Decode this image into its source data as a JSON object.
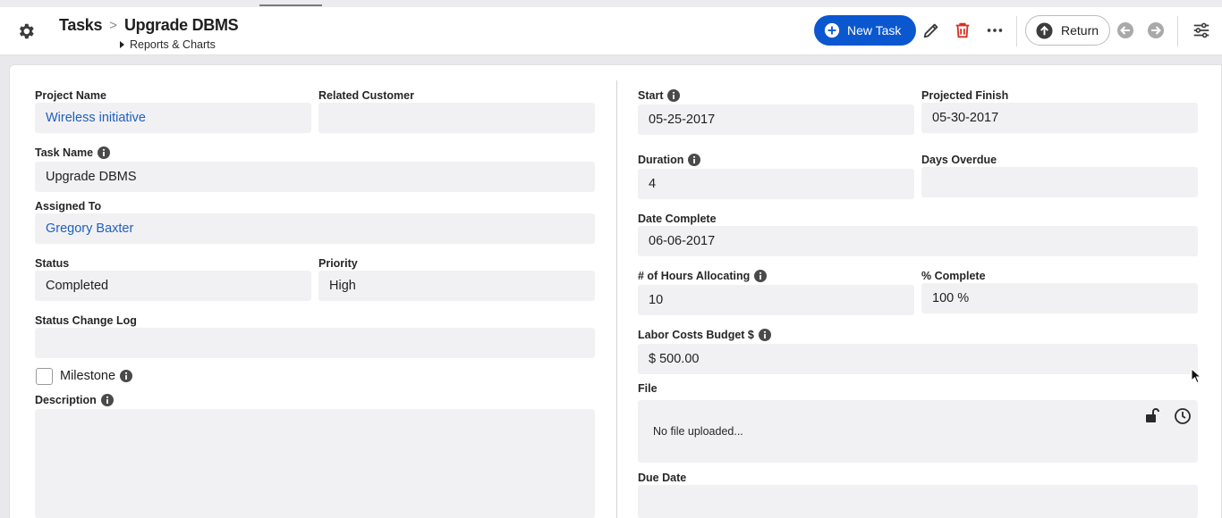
{
  "header": {
    "breadcrumb_root": "Tasks",
    "breadcrumb_sep": ">",
    "breadcrumb_current": "Upgrade DBMS",
    "subnav_label": "Reports & Charts",
    "new_task_label": "New Task",
    "return_label": "Return"
  },
  "colors": {
    "primary": "#0b57d0",
    "link": "#1f5fbf",
    "delete": "#d93025",
    "field_bg": "#f1f1f3"
  },
  "icons": [
    "gear-icon",
    "plus-circle-icon",
    "pencil-icon",
    "trash-icon",
    "more-horizontal-icon",
    "arrow-up-circle-icon",
    "arrow-left-circle-icon",
    "arrow-right-circle-icon",
    "sliders-icon",
    "info-icon",
    "unlock-icon",
    "clock-icon",
    "cursor-icon"
  ],
  "left": {
    "project_name": {
      "label": "Project Name",
      "value": "Wireless initiative"
    },
    "related_customer": {
      "label": "Related Customer",
      "value": ""
    },
    "task_name": {
      "label": "Task Name",
      "value": "Upgrade DBMS"
    },
    "assigned_to": {
      "label": "Assigned To",
      "value": "Gregory Baxter"
    },
    "status": {
      "label": "Status",
      "value": "Completed"
    },
    "priority": {
      "label": "Priority",
      "value": "High"
    },
    "status_change_log": {
      "label": "Status Change Log",
      "value": ""
    },
    "milestone": {
      "label": "Milestone",
      "checked": false
    },
    "description": {
      "label": "Description",
      "value": ""
    }
  },
  "right": {
    "start": {
      "label": "Start",
      "value": "05-25-2017"
    },
    "projected_finish": {
      "label": "Projected Finish",
      "value": "05-30-2017"
    },
    "duration": {
      "label": "Duration",
      "value": "4"
    },
    "days_overdue": {
      "label": "Days Overdue",
      "value": ""
    },
    "date_complete": {
      "label": "Date Complete",
      "value": "06-06-2017"
    },
    "hours_allocating": {
      "label": "# of Hours Allocating",
      "value": "10"
    },
    "percent_complete": {
      "label": "% Complete",
      "value": "100 %"
    },
    "labor_costs_budget": {
      "label": "Labor Costs Budget $",
      "value": "$ 500.00"
    },
    "file": {
      "label": "File",
      "value": "No file uploaded..."
    },
    "due_date": {
      "label": "Due Date",
      "value": ""
    }
  }
}
